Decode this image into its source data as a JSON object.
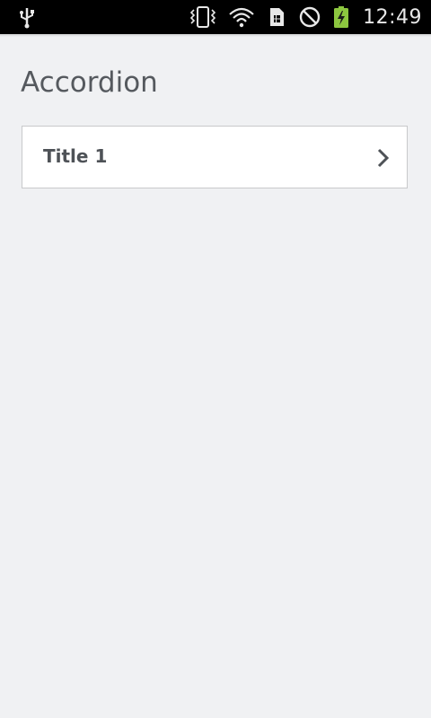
{
  "status_bar": {
    "time": "12:49",
    "icons": [
      "usb-icon",
      "vibrate-icon",
      "wifi-icon",
      "sim-icon",
      "do-not-disturb-icon",
      "battery-charging-icon"
    ],
    "battery_color": "#8cc63f"
  },
  "page": {
    "title": "Accordion"
  },
  "accordion": {
    "items": [
      {
        "title": "Title 1",
        "icon": "chevron-right-icon",
        "expanded": false
      }
    ]
  }
}
